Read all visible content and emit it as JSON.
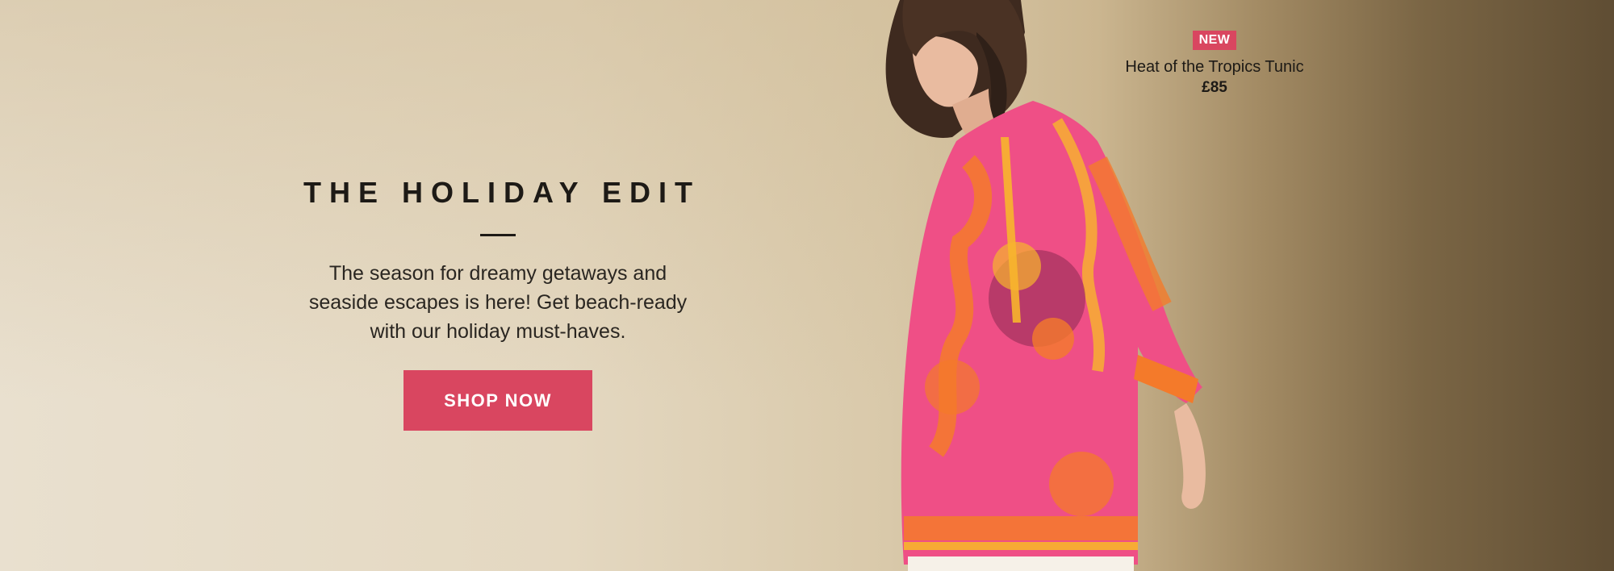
{
  "hero": {
    "title": "THE HOLIDAY EDIT",
    "body": "The season for dreamy getaways and seaside escapes is here! Get beach-ready with our holiday must-haves.",
    "cta_label": "SHOP NOW"
  },
  "product": {
    "badge": "NEW",
    "name": "Heat of the Tropics Tunic",
    "price": "£85"
  },
  "colors": {
    "accent": "#d94660",
    "text": "#1d1a16",
    "background_light": "#e9e0cf",
    "background_dark": "#5f4d33",
    "tunic_pink": "#ef4f86",
    "tunic_orange": "#f47a2a"
  },
  "icons": {
    "model_image": "woman-in-pink-tunic-image"
  }
}
